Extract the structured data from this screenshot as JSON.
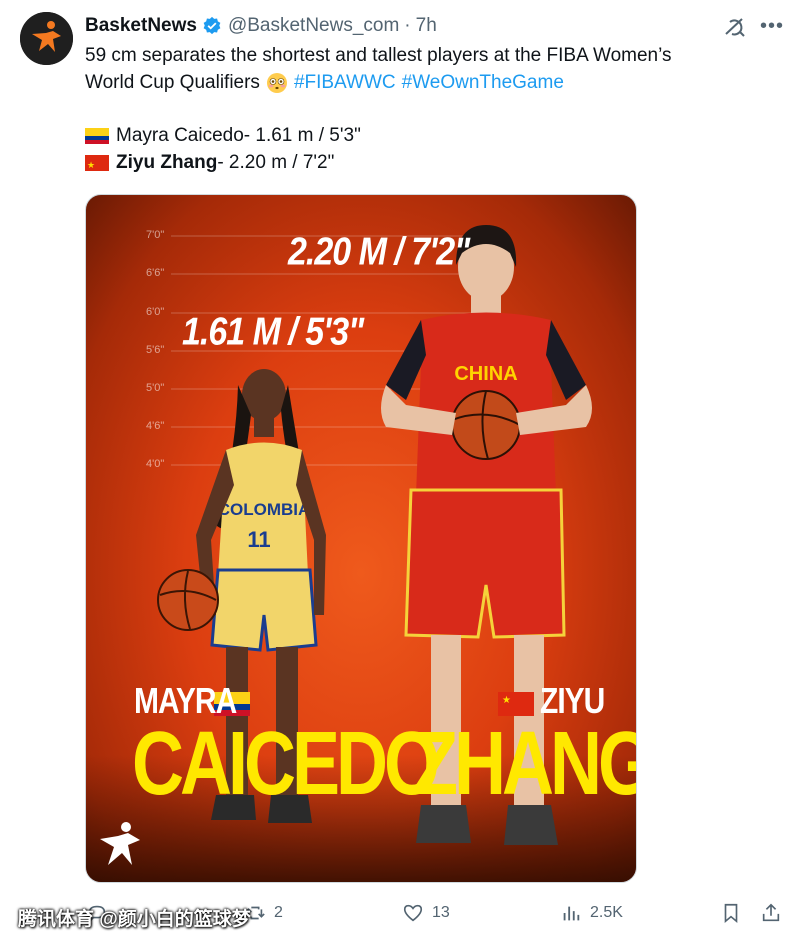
{
  "post": {
    "display_name": "BasketNews",
    "handle": "@BasketNews_com",
    "separator": "·",
    "time": "7h",
    "text_line1": "59 cm separates the shortest and tallest players at the FIBA Women’s",
    "text_line2": "World Cup Qualifiers",
    "hashtag1": "#FIBAWWC",
    "hashtag2": "#WeOwnTheGame",
    "player1_name": "Mayra Caicedo",
    "player1_height": " - 1.61 m / 5'3\"",
    "player2_name": "Ziyu Zhang",
    "player2_height": " - 2.20 m / 7'2\""
  },
  "media": {
    "tall_label": "2.20 M / 7'2\"",
    "short_label": "1.61 M / 5'3\"",
    "ticks": [
      "7'0\"",
      "6'6\"",
      "6'0\"",
      "5'6\"",
      "5'0\"",
      "4'6\"",
      "4'0\""
    ],
    "left_first": "MAYRA",
    "left_last": "CAICEDO",
    "right_first": "ZIYU",
    "right_last": "ZHANG",
    "left_jersey_team": "COLOMBIA",
    "left_jersey_number": "11",
    "right_jersey_team": "CHINA"
  },
  "actions": {
    "reply_count": "",
    "repost_count": "2",
    "like_count": "13",
    "views_count": "2.5K"
  },
  "watermark": "腾讯体育 @颜小白的篮球梦",
  "colors": {
    "accent": "#1d9bf0",
    "secondary_text": "#536471",
    "name_yellow": "#ffe800",
    "background_orange": "#dc3e10"
  }
}
